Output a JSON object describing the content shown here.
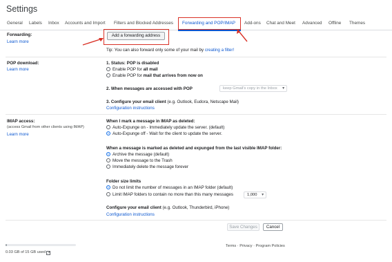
{
  "header": {
    "title": "Settings"
  },
  "tabs": [
    {
      "label": "General"
    },
    {
      "label": "Labels"
    },
    {
      "label": "Inbox"
    },
    {
      "label": "Accounts and Import"
    },
    {
      "label": "Filters and Blocked Addresses"
    },
    {
      "label": "Forwarding and POP/IMAP",
      "active": true
    },
    {
      "label": "Add-ons"
    },
    {
      "label": "Chat and Meet"
    },
    {
      "label": "Advanced"
    },
    {
      "label": "Offline"
    },
    {
      "label": "Themes"
    }
  ],
  "forwarding": {
    "label": "Forwarding:",
    "learn_more": "Learn more",
    "add_button": "Add a forwarding address",
    "tip_prefix": "Tip: You can also forward only some of your mail by ",
    "tip_link": "creating a filter!"
  },
  "pop": {
    "label": "POP download:",
    "learn_more": "Learn more",
    "status_heading": "1. Status: POP is disabled",
    "opt_all_prefix": "Enable POP for ",
    "opt_all_bold": "all mail",
    "opt_now_prefix": "Enable POP for ",
    "opt_now_bold": "mail that arrives from now on",
    "access_heading": "2. When messages are accessed with POP",
    "access_select": "keep Gmail's copy in the Inbox",
    "configure_heading": "3. Configure your email client",
    "configure_note": " (e.g. Outlook, Eudora, Netscape Mail)",
    "config_link": "Configuration instructions"
  },
  "imap": {
    "label": "IMAP access:",
    "sublabel": "(access Gmail from other clients using IMAP)",
    "learn_more": "Learn more",
    "deleted_heading": "When I mark a message in IMAP as deleted:",
    "expunge_on": "Auto-Expunge on - Immediately update the server. (default)",
    "expunge_off": "Auto-Expunge off - Wait for the client to update the server.",
    "expunged_heading": "When a message is marked as deleted and expunged from the last visible IMAP folder:",
    "archive": "Archive the message (default)",
    "trash": "Move the message to the Trash",
    "delete_forever": "Immediately delete the message forever",
    "folder_heading": "Folder size limits",
    "no_limit": "Do not limit the number of messages in an IMAP folder (default)",
    "limit": "Limit IMAP folders to contain no more than this many messages",
    "limit_value": "1,000",
    "client_heading": "Configure your email client",
    "client_note": " (e.g. Outlook, Thunderbird, iPhone)",
    "config_link": "Configuration instructions"
  },
  "actions": {
    "save": "Save Changes",
    "cancel": "Cancel"
  },
  "footer": {
    "storage": "0.03 GB of 15 GB used",
    "storage_fraction": 0.002,
    "terms": "Terms",
    "sep1": " · ",
    "privacy": "Privacy",
    "sep2": " · ",
    "policies": "Program Policies"
  },
  "colors": {
    "accent": "#0b57d0",
    "annotation_red": "#d93025"
  }
}
